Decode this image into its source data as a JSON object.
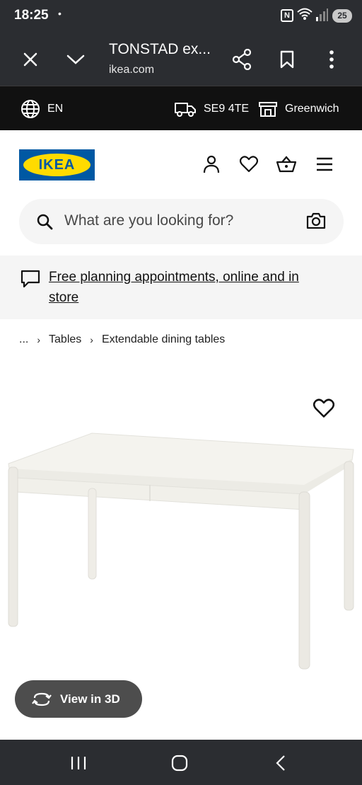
{
  "status_bar": {
    "time": "18:25",
    "dot": "•",
    "nfc": "N",
    "battery": "25"
  },
  "browser": {
    "title": "TONSTAD ex...",
    "domain": "ikea.com"
  },
  "location_bar": {
    "language": "EN",
    "postcode": "SE9 4TE",
    "store": "Greenwich"
  },
  "header": {
    "logo_text": "IKEA"
  },
  "search": {
    "placeholder": "What are you looking for?"
  },
  "banner": {
    "text": "Free planning appointments, online and in store"
  },
  "breadcrumb": {
    "items": [
      "...",
      "Tables",
      "Extendable dining tables"
    ]
  },
  "product": {
    "view3d_label": "View in 3D"
  },
  "colors": {
    "chrome": "#2b2d31",
    "locbar": "#111111",
    "ikea_blue": "#0058a3",
    "ikea_yellow": "#ffdb00",
    "banner_bg": "#f5f5f5",
    "view3d_bg": "#4d4d4d"
  }
}
